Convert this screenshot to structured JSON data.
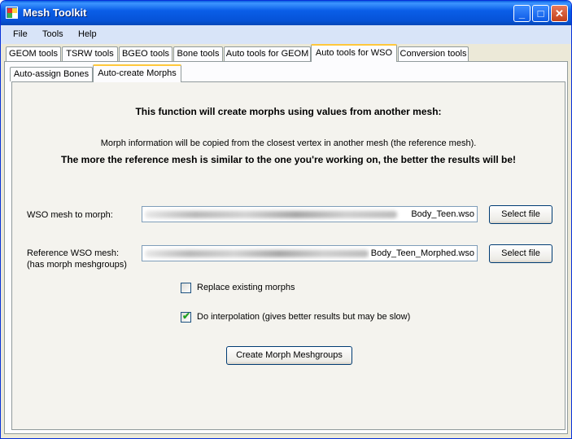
{
  "window": {
    "title": "Mesh Toolkit",
    "min": "_",
    "max": "□",
    "close": "✕"
  },
  "menu": [
    "File",
    "Tools",
    "Help"
  ],
  "main_tabs": [
    "GEOM tools",
    "TSRW tools",
    "BGEO tools",
    "Bone tools",
    "Auto tools for GEOM",
    "Auto tools for WSO",
    "Conversion tools"
  ],
  "active_main_tab": "Auto tools for WSO",
  "sub_tabs": [
    "Auto-assign Bones",
    "Auto-create Morphs"
  ],
  "active_sub_tab": "Auto-create Morphs",
  "content": {
    "heading": "This function will create morphs using values from another mesh:",
    "info": "Morph information will be copied from the closest vertex in another mesh (the reference mesh).",
    "emphasis": "The more the reference mesh is similar to the one you're working on, the better the results will be!",
    "wso_label": "WSO mesh to morph:",
    "wso_value": "Body_Teen.wso",
    "ref_label": "Reference WSO mesh:",
    "ref_sublabel": "(has morph meshgroups)",
    "ref_value": "Body_Teen_Morphed.wso",
    "select_file": "Select file",
    "replace_label": "Replace existing morphs",
    "replace_checked": false,
    "interp_label": "Do interpolation (gives better results but may be slow)",
    "interp_checked": true,
    "create_button": "Create Morph Meshgroups"
  }
}
